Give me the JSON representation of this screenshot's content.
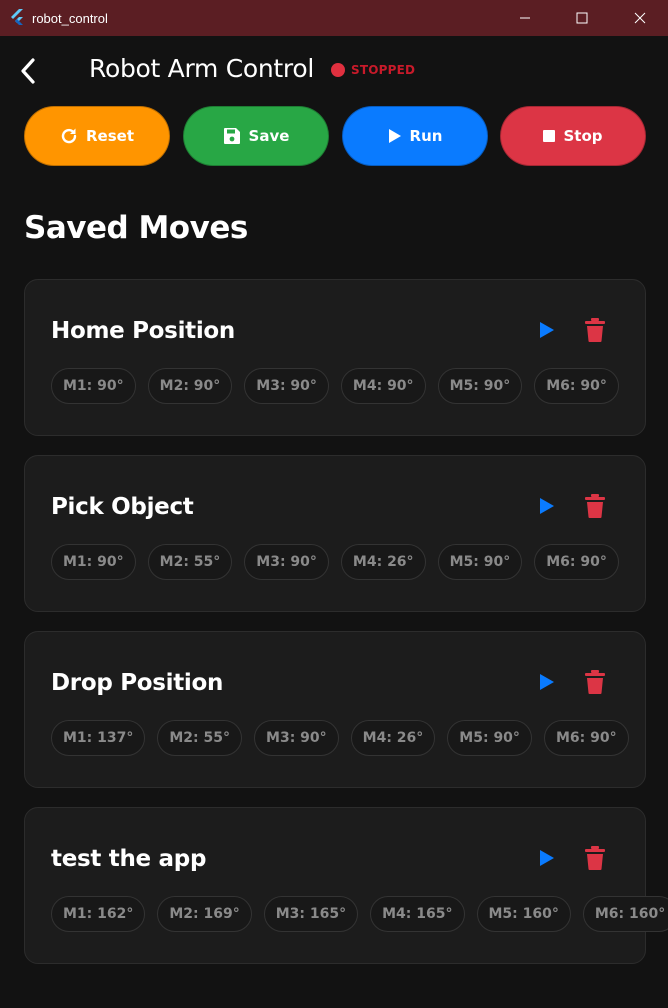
{
  "window": {
    "title": "robot_control"
  },
  "header": {
    "title": "Robot Arm Control",
    "status": "STOPPED"
  },
  "actions": {
    "reset": "Reset",
    "save": "Save",
    "run": "Run",
    "stop": "Stop"
  },
  "section_title": "Saved Moves",
  "moves": [
    {
      "name": "Home Position",
      "motors": [
        "M1: 90°",
        "M2: 90°",
        "M3: 90°",
        "M4: 90°",
        "M5: 90°",
        "M6: 90°"
      ]
    },
    {
      "name": "Pick Object",
      "motors": [
        "M1: 90°",
        "M2: 55°",
        "M3: 90°",
        "M4: 26°",
        "M5: 90°",
        "M6: 90°"
      ]
    },
    {
      "name": "Drop Position",
      "motors": [
        "M1: 137°",
        "M2: 55°",
        "M3: 90°",
        "M4: 26°",
        "M5: 90°",
        "M6: 90°"
      ]
    },
    {
      "name": "test the app",
      "motors": [
        "M1: 162°",
        "M2: 169°",
        "M3: 165°",
        "M4: 165°",
        "M5: 160°",
        "M6: 160°"
      ]
    }
  ],
  "colors": {
    "titlebar": "#5b1e23",
    "background": "#121212",
    "card": "#1c1c1c",
    "reset": "#ff9500",
    "save": "#28a745",
    "run": "#0a7bff",
    "stop": "#dc3545",
    "status": "#e0303f"
  }
}
